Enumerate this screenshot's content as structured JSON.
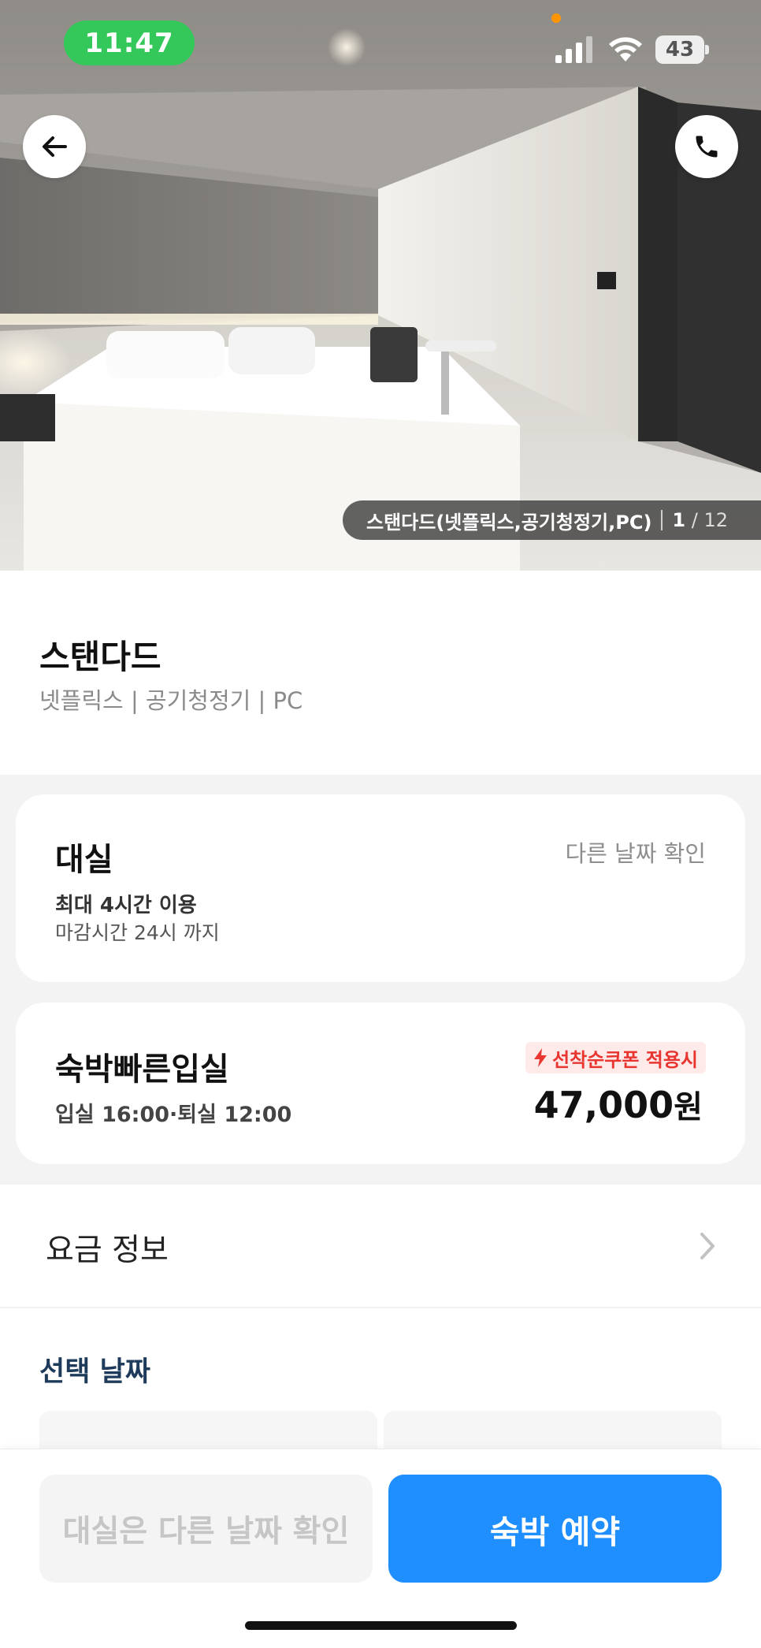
{
  "status_bar": {
    "time": "11:47",
    "battery": "43",
    "colors": {
      "time_pill": "#34c759",
      "privacy_dot": "#ff9500"
    }
  },
  "hero": {
    "back_icon": "arrow-left-icon",
    "call_icon": "phone-icon",
    "photo_caption": "스탠다드(넷플릭스,공기청정기,PC)",
    "photo_index": "1",
    "photo_total": "/ 12"
  },
  "room": {
    "name": "스탠다드",
    "amenities": "넷플릭스 | 공기청정기 | PC"
  },
  "rental": {
    "title": "대실",
    "other_date": "다른 날짜 확인",
    "usage": "최대 4시간 이용",
    "deadline": "마감시간 24시 까지"
  },
  "stay": {
    "title": "숙박빠른입실",
    "checkin_out": "입실 16:00·퇴실 12:00",
    "coupon_icon": "lightning-icon",
    "coupon": "선착순쿠폰 적용시",
    "price": "47,000",
    "currency": "원"
  },
  "fee_info": {
    "label": "요금 정보",
    "icon": "chevron-right-icon"
  },
  "selected_date": {
    "label": "선택 날짜"
  },
  "bottom": {
    "rental_button": "대실은 다른 날짜 확인",
    "stay_button": "숙박 예약",
    "colors": {
      "primary": "#1f8fff",
      "coupon_red": "#e8352f"
    }
  }
}
